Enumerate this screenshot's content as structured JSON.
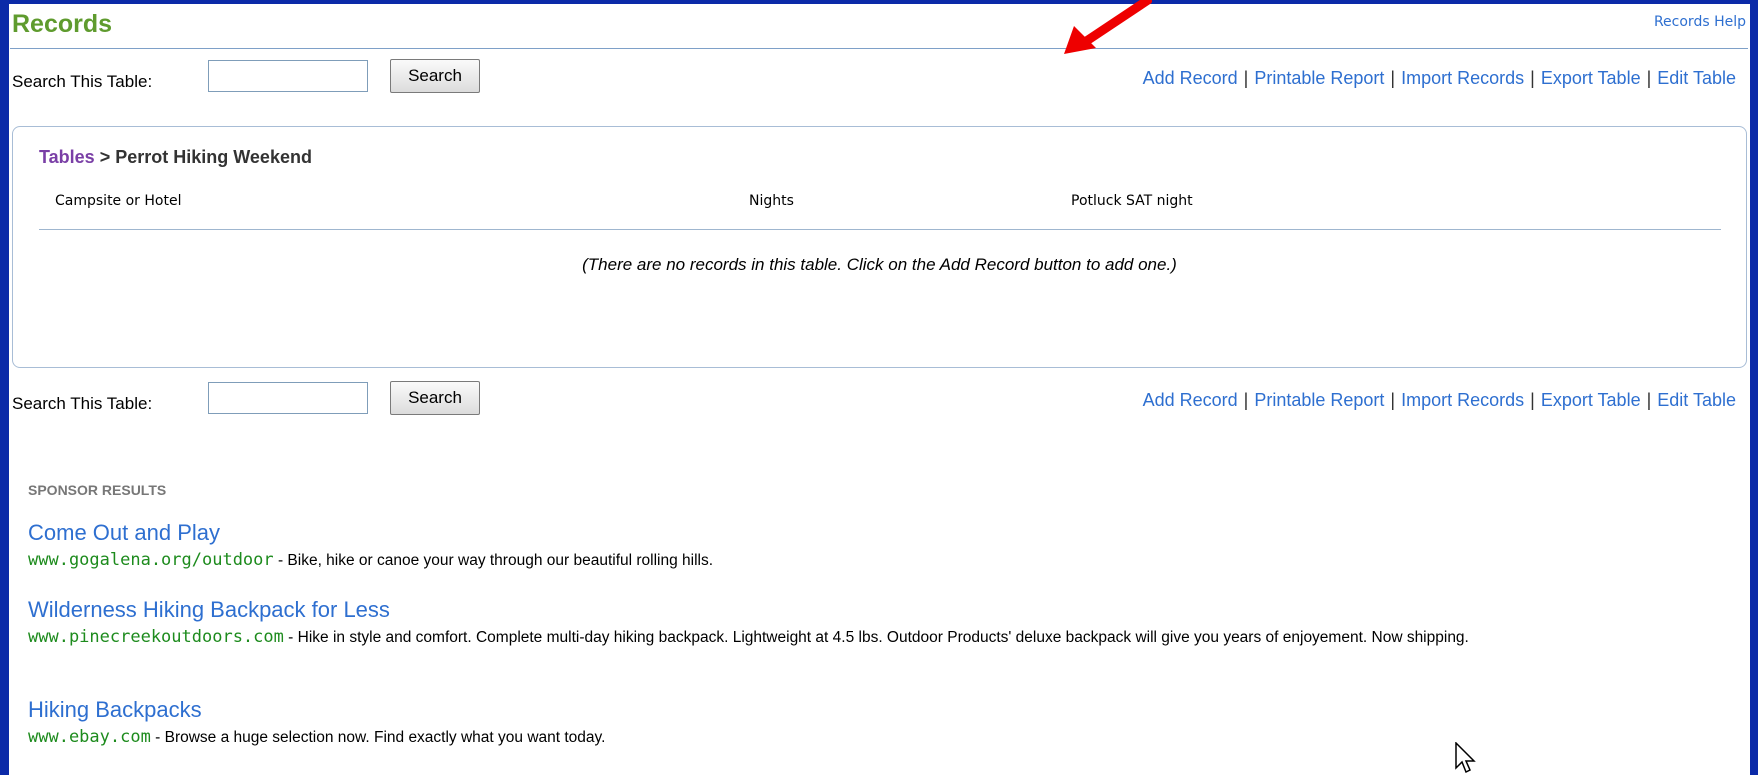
{
  "page": {
    "title": "Records",
    "help_link": "Records Help"
  },
  "search": {
    "label": "Search This Table:",
    "button": "Search",
    "value": ""
  },
  "actions": [
    "Add Record",
    "Printable Report",
    "Import Records",
    "Export Table",
    "Edit Table"
  ],
  "breadcrumb": {
    "root": "Tables",
    "separator": ">",
    "current": "Perrot Hiking Weekend"
  },
  "table": {
    "columns": [
      "Campsite or Hotel",
      "Nights",
      "Potluck SAT night"
    ],
    "empty_message": "(There are no records in this table.  Click on the Add Record button to add one.)"
  },
  "sponsor": {
    "heading": "SPONSOR RESULTS",
    "ads": [
      {
        "title": "Come Out and Play",
        "url": "www.gogalena.org/outdoor",
        "description": " - Bike, hike or canoe your way through our beautiful rolling hills."
      },
      {
        "title": "Wilderness Hiking Backpack for Less",
        "url": "www.pinecreekoutdoors.com",
        "description": " - Hike in style and comfort. Complete multi-day hiking backpack. Lightweight at 4.5 lbs. Outdoor Products' deluxe backpack will give you years of enjoyement. Now shipping."
      },
      {
        "title": "Hiking Backpacks",
        "url": "www.ebay.com",
        "description": " - Browse a huge selection now. Find exactly what you want today."
      }
    ]
  },
  "colors": {
    "frame": "#0b2aa8",
    "title_green": "#5f9b2e",
    "link_blue": "#2e6fd0",
    "url_green": "#1d8b1d",
    "breadcrumb_purple": "#7a3fa6",
    "arrow_red": "#ee0000"
  }
}
